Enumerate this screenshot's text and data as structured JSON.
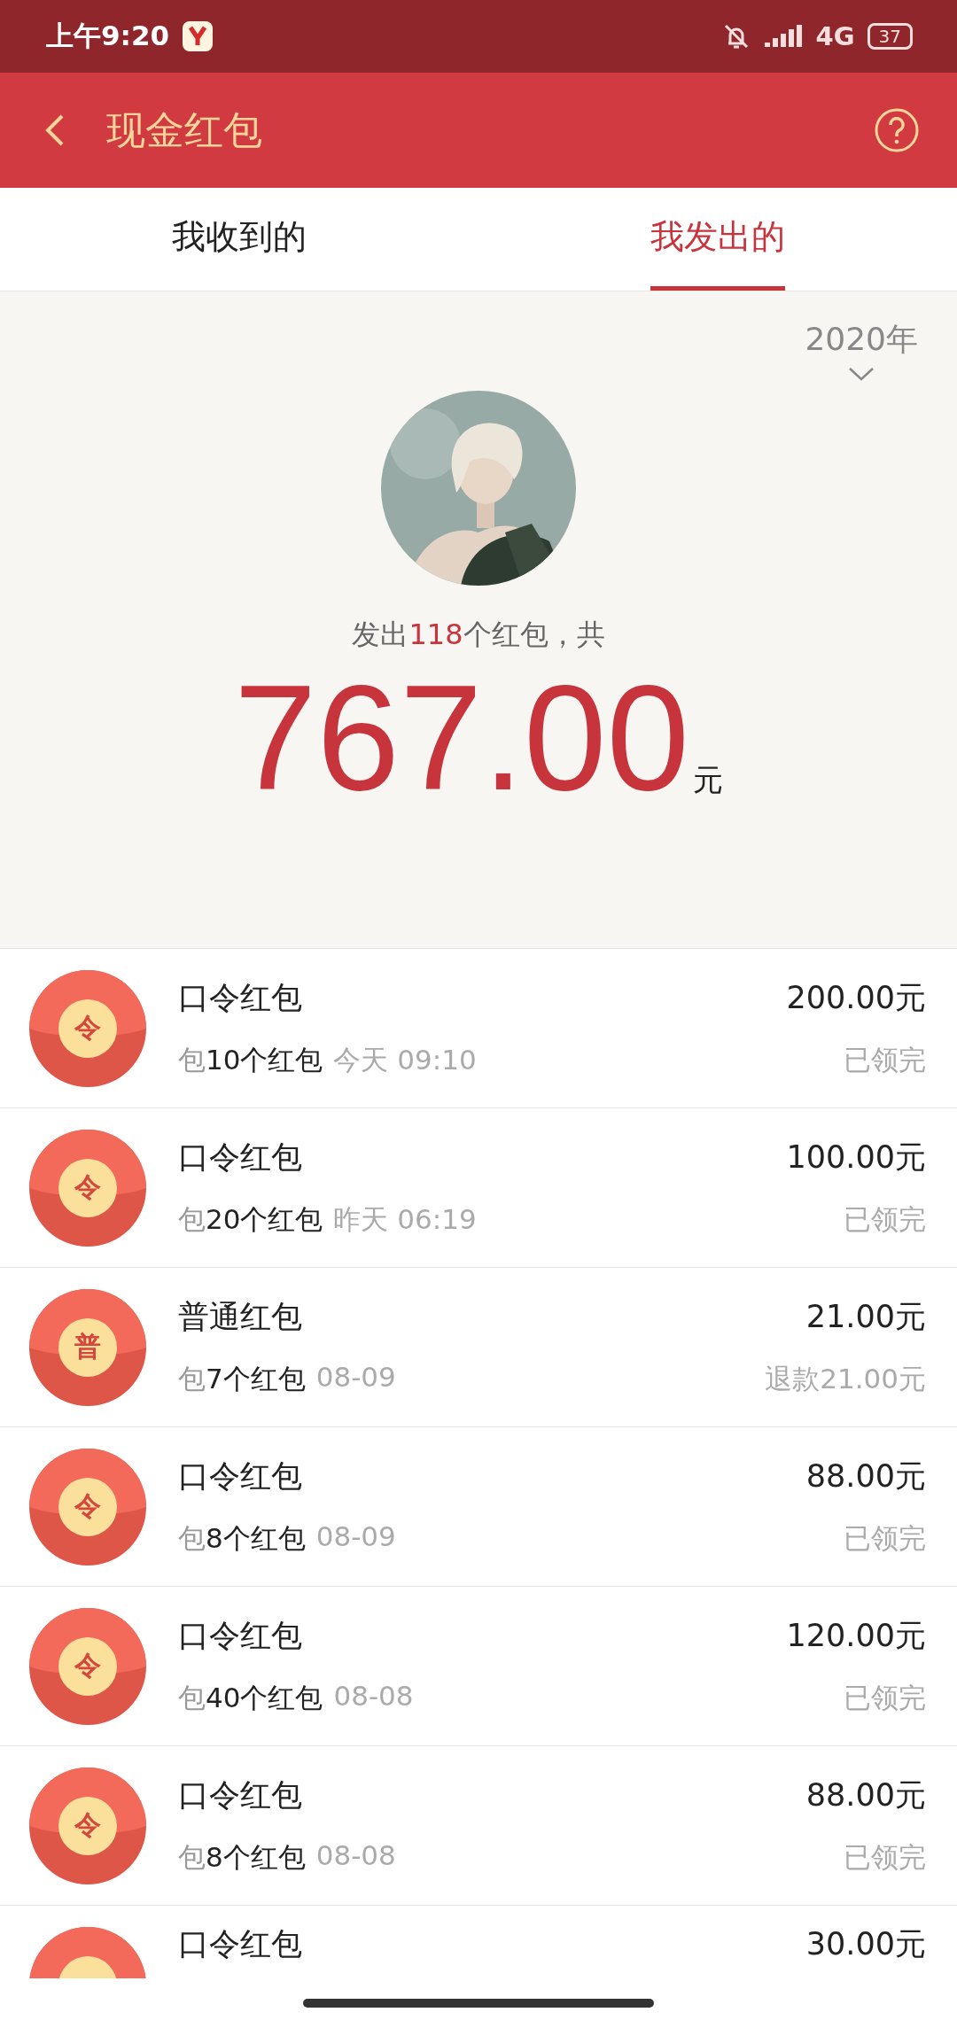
{
  "status_bar": {
    "time": "上午9:20",
    "network": "4G",
    "battery": "37"
  },
  "header": {
    "title": "现金红包"
  },
  "tabs": [
    {
      "label": "我收到的",
      "selected": false
    },
    {
      "label": "我发出的",
      "selected": true
    }
  ],
  "summary": {
    "year": "2020年",
    "text_before": "发出",
    "count": "118",
    "text_after": "个红包，共",
    "amount": "767.00",
    "unit": "元"
  },
  "items": [
    {
      "seal": "令",
      "title": "口令红包",
      "prefix": "包",
      "count": "10个红包",
      "time": "今天 09:10",
      "amount": "200.00元",
      "status": "已领完"
    },
    {
      "seal": "令",
      "title": "口令红包",
      "prefix": "包",
      "count": "20个红包",
      "time": "昨天 06:19",
      "amount": "100.00元",
      "status": "已领完"
    },
    {
      "seal": "普",
      "title": "普通红包",
      "prefix": "包",
      "count": "7个红包",
      "time": "08-09",
      "amount": "21.00元",
      "status": "退款21.00元"
    },
    {
      "seal": "令",
      "title": "口令红包",
      "prefix": "包",
      "count": "8个红包",
      "time": "08-09",
      "amount": "88.00元",
      "status": "已领完"
    },
    {
      "seal": "令",
      "title": "口令红包",
      "prefix": "包",
      "count": "40个红包",
      "time": "08-08",
      "amount": "120.00元",
      "status": "已领完"
    },
    {
      "seal": "令",
      "title": "口令红包",
      "prefix": "包",
      "count": "8个红包",
      "time": "08-08",
      "amount": "88.00元",
      "status": "已领完"
    },
    {
      "title": "口令红包",
      "amount": "30.00元"
    }
  ]
}
